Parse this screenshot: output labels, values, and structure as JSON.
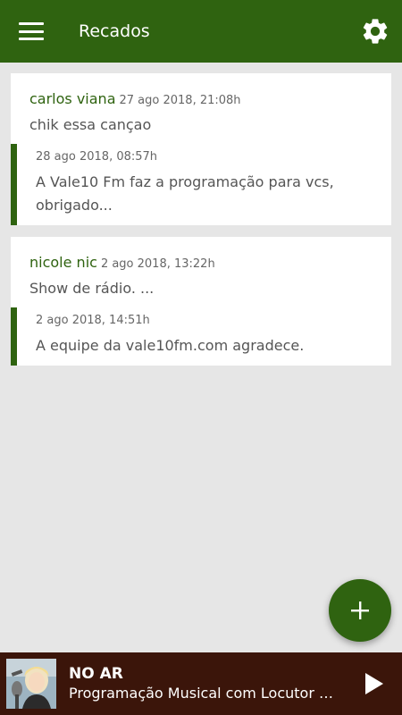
{
  "appbar": {
    "title": "Recados",
    "menu_icon": "hamburger-menu-icon",
    "settings_icon": "gear-icon"
  },
  "colors": {
    "primary": "#2f6310",
    "background": "#e6e6e6",
    "player_bg": "#3b150a"
  },
  "messages": [
    {
      "author": "carlos viana",
      "date": "27 ago 2018, 21:08h",
      "text": "chik essa cançao",
      "reply": {
        "date": "28 ago 2018, 08:57h",
        "text": "A Vale10 Fm  faz a programação para vcs, obrigado..."
      }
    },
    {
      "author": "nicole nic",
      "date": "2 ago 2018, 13:22h",
      "text": "Show de rádio. ...",
      "reply": {
        "date": "2 ago 2018, 14:51h",
        "text": "A equipe da vale10fm.com  agradece."
      }
    }
  ],
  "fab": {
    "icon": "plus-icon"
  },
  "player": {
    "status": "NO AR",
    "program": "Programação Musical com Locutor Virtual",
    "play_icon": "play-icon"
  }
}
